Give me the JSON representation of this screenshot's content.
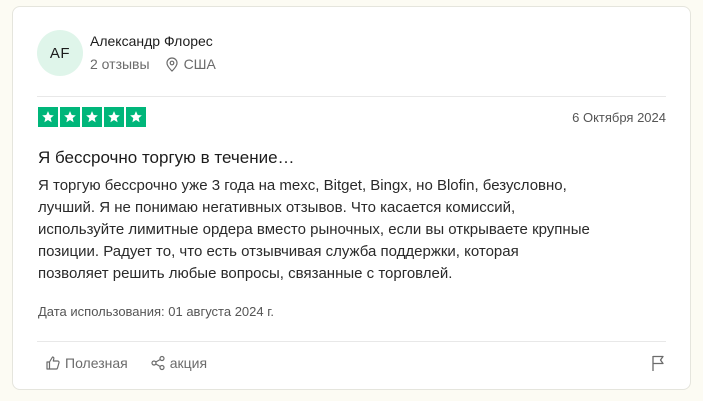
{
  "reviewer": {
    "initials": "AF",
    "name": "Александр Флорес",
    "reviews_count": "2 отзывы",
    "country": "США",
    "avatar_color": "#dff5ea"
  },
  "review": {
    "rating": 5,
    "rating_max": 5,
    "star_color": "#00b67a",
    "date": "6 Октября 2024",
    "title": "Я бессрочно торгую в течение…",
    "body_lines": [
      "Я торгую бессрочно уже 3 года на mexc, Bitget, Bingx, но Blofin, безусловно,",
      "лучший. Я не понимаю негативных отзывов. Что касается комиссий,",
      "используйте лимитные ордера вместо рыночных, если вы открываете крупные",
      "позиции. Радует то, что есть отзывчивая служба поддержки, которая",
      "позволяет решить любые вопросы, связанные с торговлей."
    ],
    "date_of_experience": "Дата использования: 01 августа 2024 г."
  },
  "actions": {
    "useful_label": "Полезная",
    "share_label": "акция",
    "icons": {
      "useful": "thumbs-up-icon",
      "share": "share-icon",
      "report": "flag-icon",
      "location": "location-pin-icon",
      "star": "star-icon"
    }
  }
}
